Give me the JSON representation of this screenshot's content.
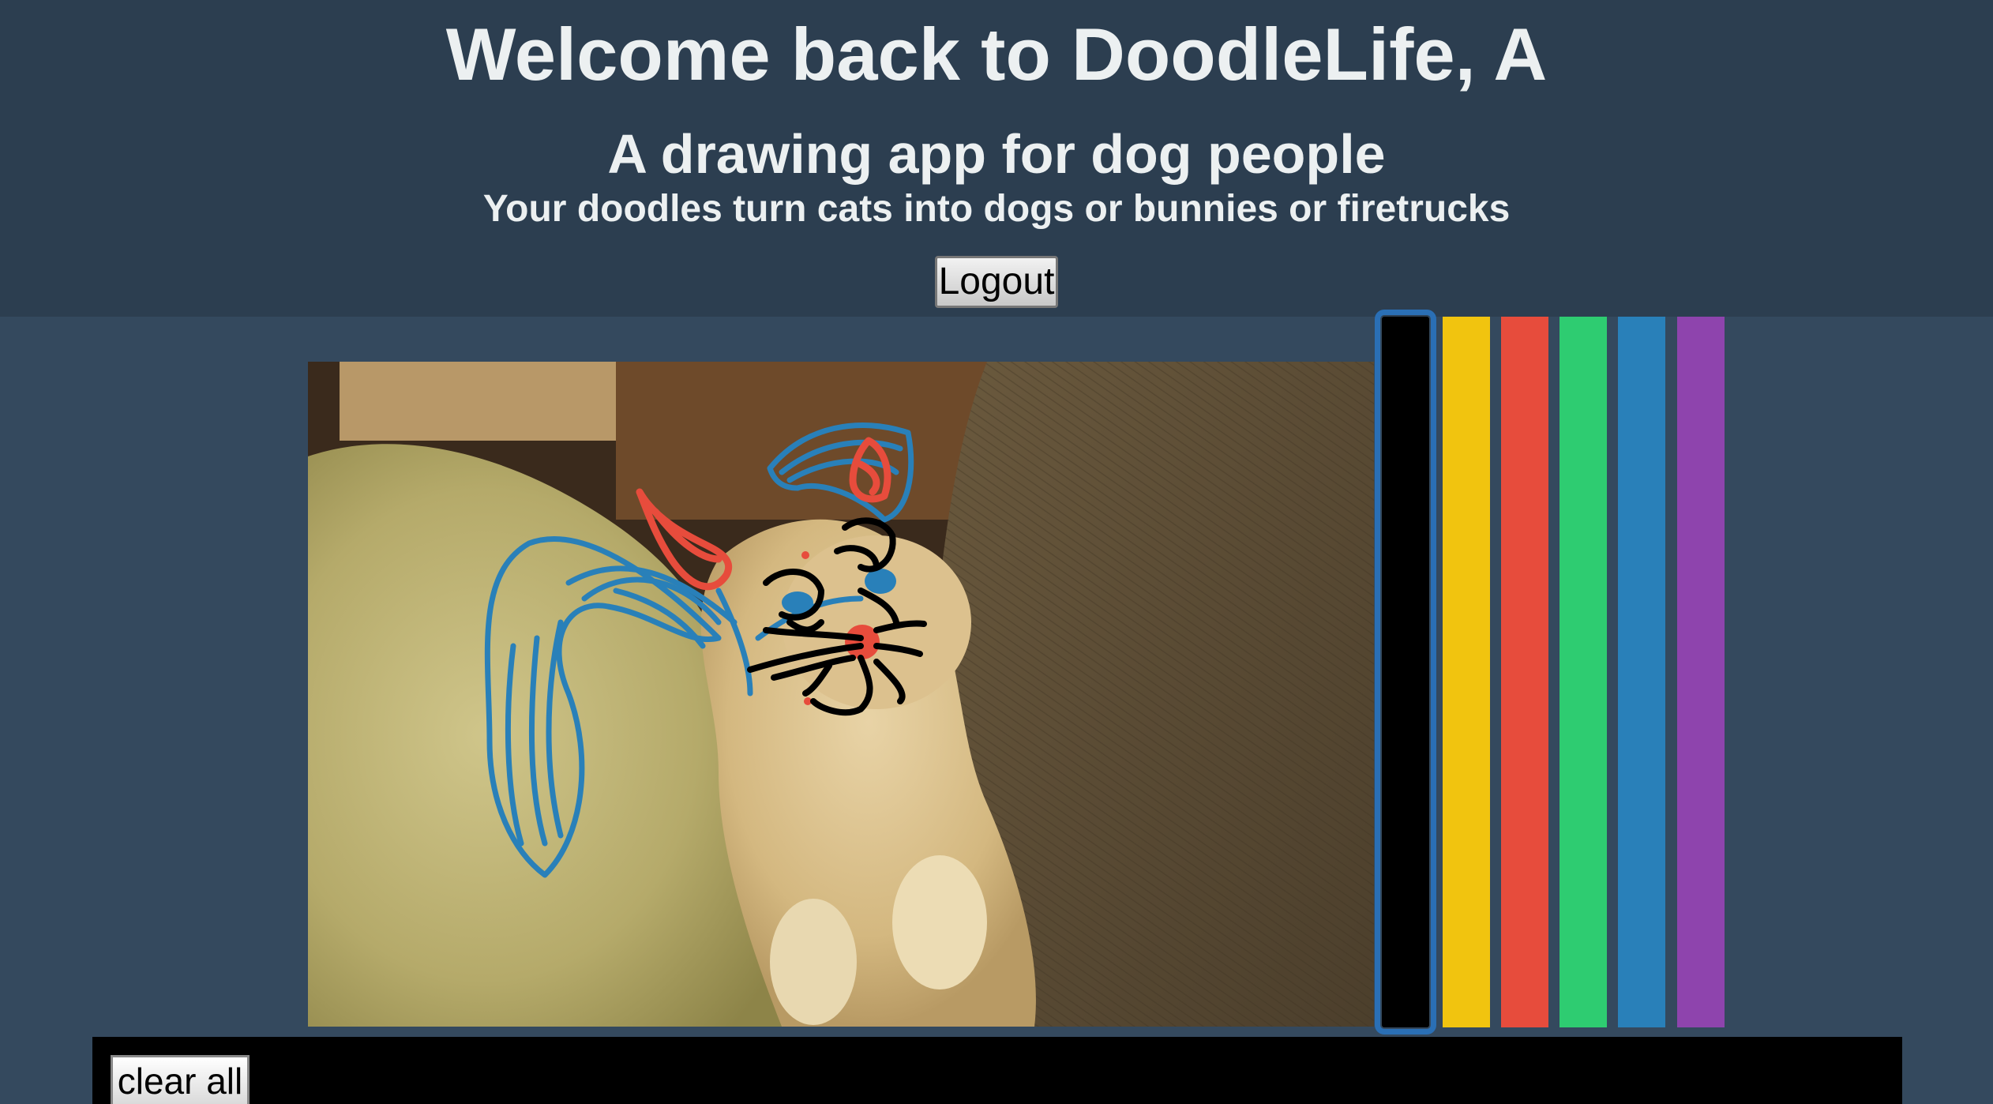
{
  "header": {
    "title": "Welcome back to DoodleLife, A",
    "subtitle": "A drawing app for dog people",
    "tagline": "Your doodles turn cats into dogs or bunnies or firetrucks",
    "logout_label": "Logout"
  },
  "palette": {
    "colors": [
      {
        "name": "black",
        "hex": "#000000",
        "selected": true
      },
      {
        "name": "yellow",
        "hex": "#f1c40f",
        "selected": false
      },
      {
        "name": "red",
        "hex": "#e74c3c",
        "selected": false
      },
      {
        "name": "green",
        "hex": "#2ecc71",
        "selected": false
      },
      {
        "name": "blue",
        "hex": "#2980b9",
        "selected": false
      },
      {
        "name": "purple",
        "hex": "#8e44ad",
        "selected": false
      }
    ]
  },
  "toolbar": {
    "clear_label": "clear all"
  },
  "theme": {
    "header_bg": "#2c3e50",
    "body_bg": "#34495e",
    "text": "#ecf0f1"
  }
}
